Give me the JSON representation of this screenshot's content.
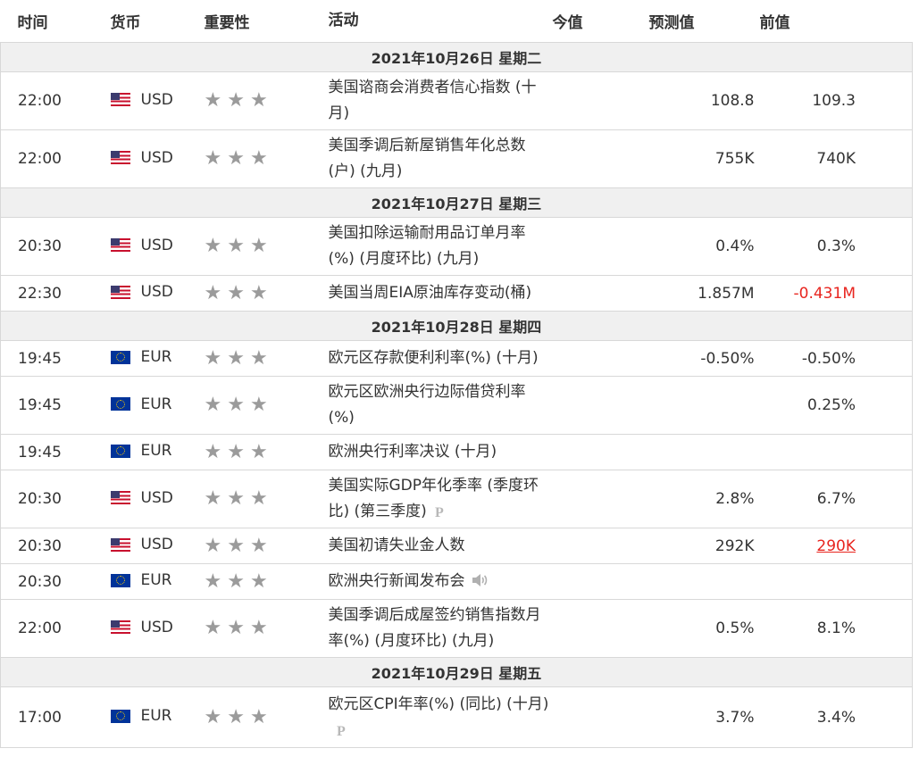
{
  "header": {
    "time": "时间",
    "currency": "货币",
    "importance": "重要性",
    "event": "活动",
    "actual": "今值",
    "forecast": "预测值",
    "previous": "前值"
  },
  "groups": [
    {
      "date": "2021年10月26日  星期二",
      "rows": [
        {
          "time": "22:00",
          "flag": "us-flag-icon",
          "currency": "USD",
          "stars": 3,
          "event": "美国谘商会消费者信心指数 (十月)",
          "actual": "",
          "forecast": "108.8",
          "previous": "109.3",
          "prev_style": "normal",
          "icon": ""
        },
        {
          "time": "22:00",
          "flag": "us-flag-icon",
          "currency": "USD",
          "stars": 3,
          "event": "美国季调后新屋销售年化总数 (户) (九月)",
          "actual": "",
          "forecast": "755K",
          "previous": "740K",
          "prev_style": "normal",
          "icon": ""
        }
      ]
    },
    {
      "date": "2021年10月27日  星期三",
      "rows": [
        {
          "time": "20:30",
          "flag": "us-flag-icon",
          "currency": "USD",
          "stars": 3,
          "event": "美国扣除运输耐用品订单月率 (%) (月度环比) (九月)",
          "actual": "",
          "forecast": "0.4%",
          "previous": "0.3%",
          "prev_style": "normal",
          "icon": ""
        },
        {
          "time": "22:30",
          "flag": "us-flag-icon",
          "currency": "USD",
          "stars": 3,
          "event": "美国当周EIA原油库存变动(桶)",
          "actual": "",
          "forecast": "1.857M",
          "previous": "-0.431M",
          "prev_style": "negative",
          "icon": ""
        }
      ]
    },
    {
      "date": "2021年10月28日  星期四",
      "rows": [
        {
          "time": "19:45",
          "flag": "eu-flag-icon",
          "currency": "EUR",
          "stars": 3,
          "event": "欧元区存款便利利率(%) (十月)",
          "actual": "",
          "forecast": "-0.50%",
          "previous": "-0.50%",
          "prev_style": "normal",
          "icon": ""
        },
        {
          "time": "19:45",
          "flag": "eu-flag-icon",
          "currency": "EUR",
          "stars": 3,
          "event": "欧元区欧洲央行边际借贷利率 (%)",
          "actual": "",
          "forecast": "",
          "previous": "0.25%",
          "prev_style": "normal",
          "icon": ""
        },
        {
          "time": "19:45",
          "flag": "eu-flag-icon",
          "currency": "EUR",
          "stars": 3,
          "event": "欧洲央行利率决议 (十月)",
          "actual": "",
          "forecast": "",
          "previous": "",
          "prev_style": "normal",
          "icon": ""
        },
        {
          "time": "20:30",
          "flag": "us-flag-icon",
          "currency": "USD",
          "stars": 3,
          "event": "美国实际GDP年化季率 (季度环比) (第三季度)",
          "actual": "",
          "forecast": "2.8%",
          "previous": "6.7%",
          "prev_style": "normal",
          "icon": "preliminary-icon"
        },
        {
          "time": "20:30",
          "flag": "us-flag-icon",
          "currency": "USD",
          "stars": 3,
          "event": "美国初请失业金人数",
          "actual": "",
          "forecast": "292K",
          "previous": "290K",
          "prev_style": "revised",
          "icon": ""
        },
        {
          "time": "20:30",
          "flag": "eu-flag-icon",
          "currency": "EUR",
          "stars": 3,
          "event": "欧洲央行新闻发布会",
          "actual": "",
          "forecast": "",
          "previous": "",
          "prev_style": "normal",
          "icon": "speaker-icon"
        },
        {
          "time": "22:00",
          "flag": "us-flag-icon",
          "currency": "USD",
          "stars": 3,
          "event": "美国季调后成屋签约销售指数月率(%) (月度环比) (九月)",
          "actual": "",
          "forecast": "0.5%",
          "previous": "8.1%",
          "prev_style": "normal",
          "icon": ""
        }
      ]
    },
    {
      "date": "2021年10月29日  星期五",
      "rows": [
        {
          "time": "17:00",
          "flag": "eu-flag-icon",
          "currency": "EUR",
          "stars": 3,
          "event": "欧元区CPI年率(%) (同比) (十月)",
          "actual": "",
          "forecast": "3.7%",
          "previous": "3.4%",
          "prev_style": "normal",
          "icon": "preliminary-icon"
        }
      ]
    }
  ]
}
